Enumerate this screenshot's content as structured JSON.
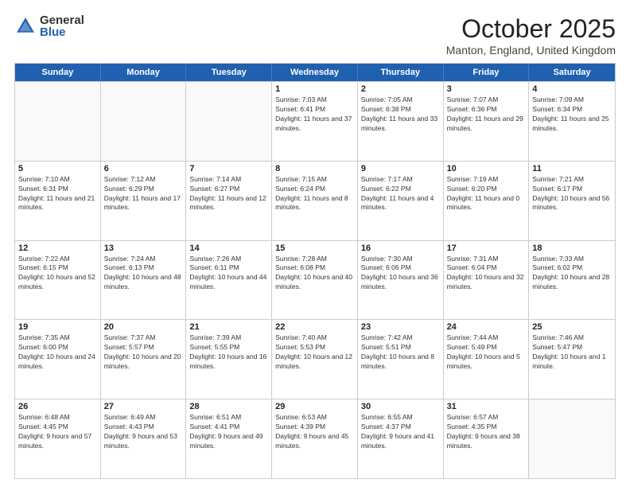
{
  "logo": {
    "general": "General",
    "blue": "Blue"
  },
  "title": "October 2025",
  "location": "Manton, England, United Kingdom",
  "days_of_week": [
    "Sunday",
    "Monday",
    "Tuesday",
    "Wednesday",
    "Thursday",
    "Friday",
    "Saturday"
  ],
  "weeks": [
    [
      {
        "day": "",
        "info": ""
      },
      {
        "day": "",
        "info": ""
      },
      {
        "day": "",
        "info": ""
      },
      {
        "day": "1",
        "info": "Sunrise: 7:03 AM\nSunset: 6:41 PM\nDaylight: 11 hours and 37 minutes."
      },
      {
        "day": "2",
        "info": "Sunrise: 7:05 AM\nSunset: 6:38 PM\nDaylight: 11 hours and 33 minutes."
      },
      {
        "day": "3",
        "info": "Sunrise: 7:07 AM\nSunset: 6:36 PM\nDaylight: 11 hours and 29 minutes."
      },
      {
        "day": "4",
        "info": "Sunrise: 7:09 AM\nSunset: 6:34 PM\nDaylight: 11 hours and 25 minutes."
      }
    ],
    [
      {
        "day": "5",
        "info": "Sunrise: 7:10 AM\nSunset: 6:31 PM\nDaylight: 11 hours and 21 minutes."
      },
      {
        "day": "6",
        "info": "Sunrise: 7:12 AM\nSunset: 6:29 PM\nDaylight: 11 hours and 17 minutes."
      },
      {
        "day": "7",
        "info": "Sunrise: 7:14 AM\nSunset: 6:27 PM\nDaylight: 11 hours and 12 minutes."
      },
      {
        "day": "8",
        "info": "Sunrise: 7:15 AM\nSunset: 6:24 PM\nDaylight: 11 hours and 8 minutes."
      },
      {
        "day": "9",
        "info": "Sunrise: 7:17 AM\nSunset: 6:22 PM\nDaylight: 11 hours and 4 minutes."
      },
      {
        "day": "10",
        "info": "Sunrise: 7:19 AM\nSunset: 6:20 PM\nDaylight: 11 hours and 0 minutes."
      },
      {
        "day": "11",
        "info": "Sunrise: 7:21 AM\nSunset: 6:17 PM\nDaylight: 10 hours and 56 minutes."
      }
    ],
    [
      {
        "day": "12",
        "info": "Sunrise: 7:22 AM\nSunset: 6:15 PM\nDaylight: 10 hours and 52 minutes."
      },
      {
        "day": "13",
        "info": "Sunrise: 7:24 AM\nSunset: 6:13 PM\nDaylight: 10 hours and 48 minutes."
      },
      {
        "day": "14",
        "info": "Sunrise: 7:26 AM\nSunset: 6:11 PM\nDaylight: 10 hours and 44 minutes."
      },
      {
        "day": "15",
        "info": "Sunrise: 7:28 AM\nSunset: 6:08 PM\nDaylight: 10 hours and 40 minutes."
      },
      {
        "day": "16",
        "info": "Sunrise: 7:30 AM\nSunset: 6:06 PM\nDaylight: 10 hours and 36 minutes."
      },
      {
        "day": "17",
        "info": "Sunrise: 7:31 AM\nSunset: 6:04 PM\nDaylight: 10 hours and 32 minutes."
      },
      {
        "day": "18",
        "info": "Sunrise: 7:33 AM\nSunset: 6:02 PM\nDaylight: 10 hours and 28 minutes."
      }
    ],
    [
      {
        "day": "19",
        "info": "Sunrise: 7:35 AM\nSunset: 6:00 PM\nDaylight: 10 hours and 24 minutes."
      },
      {
        "day": "20",
        "info": "Sunrise: 7:37 AM\nSunset: 5:57 PM\nDaylight: 10 hours and 20 minutes."
      },
      {
        "day": "21",
        "info": "Sunrise: 7:39 AM\nSunset: 5:55 PM\nDaylight: 10 hours and 16 minutes."
      },
      {
        "day": "22",
        "info": "Sunrise: 7:40 AM\nSunset: 5:53 PM\nDaylight: 10 hours and 12 minutes."
      },
      {
        "day": "23",
        "info": "Sunrise: 7:42 AM\nSunset: 5:51 PM\nDaylight: 10 hours and 8 minutes."
      },
      {
        "day": "24",
        "info": "Sunrise: 7:44 AM\nSunset: 5:49 PM\nDaylight: 10 hours and 5 minutes."
      },
      {
        "day": "25",
        "info": "Sunrise: 7:46 AM\nSunset: 5:47 PM\nDaylight: 10 hours and 1 minute."
      }
    ],
    [
      {
        "day": "26",
        "info": "Sunrise: 6:48 AM\nSunset: 4:45 PM\nDaylight: 9 hours and 57 minutes."
      },
      {
        "day": "27",
        "info": "Sunrise: 6:49 AM\nSunset: 4:43 PM\nDaylight: 9 hours and 53 minutes."
      },
      {
        "day": "28",
        "info": "Sunrise: 6:51 AM\nSunset: 4:41 PM\nDaylight: 9 hours and 49 minutes."
      },
      {
        "day": "29",
        "info": "Sunrise: 6:53 AM\nSunset: 4:39 PM\nDaylight: 9 hours and 45 minutes."
      },
      {
        "day": "30",
        "info": "Sunrise: 6:55 AM\nSunset: 4:37 PM\nDaylight: 9 hours and 41 minutes."
      },
      {
        "day": "31",
        "info": "Sunrise: 6:57 AM\nSunset: 4:35 PM\nDaylight: 9 hours and 38 minutes."
      },
      {
        "day": "",
        "info": ""
      }
    ]
  ]
}
